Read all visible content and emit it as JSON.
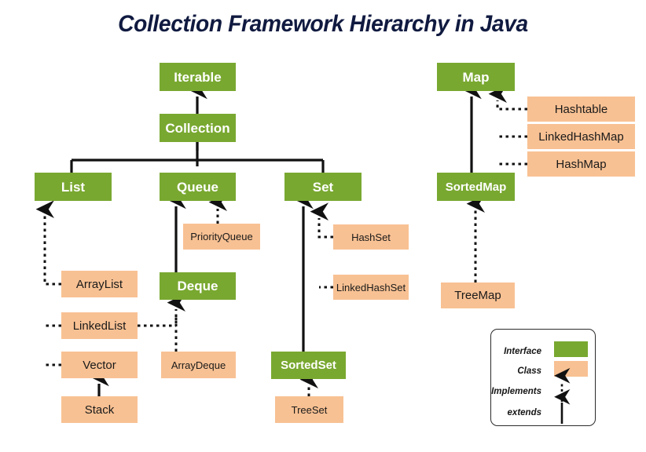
{
  "title": "Collection Framework Hierarchy in Java",
  "colors": {
    "interface": "#79a830",
    "class": "#f8c193",
    "title": "#101a40",
    "line": "#111111",
    "background": "#ffffff"
  },
  "nodes": {
    "iterable": "Iterable",
    "collection": "Collection",
    "list": "List",
    "queue": "Queue",
    "set": "Set",
    "arraylist": "ArrayList",
    "linkedlist": "LinkedList",
    "vector": "Vector",
    "stack": "Stack",
    "priorityqueue": "PriorityQueue",
    "deque": "Deque",
    "arraydeque": "ArrayDeque",
    "hashset": "HashSet",
    "linkedhashset": "LinkedHashSet",
    "sortedset": "SortedSet",
    "treeset": "TreeSet",
    "map": "Map",
    "hashtable": "Hashtable",
    "linkedhashmap": "LinkedHashMap",
    "hashmap": "HashMap",
    "sortedmap": "SortedMap",
    "treemap": "TreeMap"
  },
  "legend": {
    "interface_label": "Interface",
    "class_label": "Class",
    "implements_label": "Implements",
    "extends_label": "extends"
  },
  "chart_data": {
    "type": "diagram",
    "title": "Collection Framework Hierarchy in Java",
    "node_kinds": {
      "interface": [
        "Iterable",
        "Collection",
        "List",
        "Queue",
        "Set",
        "Deque",
        "SortedSet",
        "Map",
        "SortedMap"
      ],
      "class": [
        "ArrayList",
        "LinkedList",
        "Vector",
        "Stack",
        "PriorityQueue",
        "ArrayDeque",
        "HashSet",
        "LinkedHashSet",
        "TreeSet",
        "Hashtable",
        "LinkedHashMap",
        "HashMap",
        "TreeMap"
      ]
    },
    "edges": [
      {
        "from": "Collection",
        "to": "Iterable",
        "kind": "extends"
      },
      {
        "from": "List",
        "to": "Collection",
        "kind": "extends"
      },
      {
        "from": "Queue",
        "to": "Collection",
        "kind": "extends"
      },
      {
        "from": "Set",
        "to": "Collection",
        "kind": "extends"
      },
      {
        "from": "ArrayList",
        "to": "List",
        "kind": "implements"
      },
      {
        "from": "LinkedList",
        "to": "List",
        "kind": "implements"
      },
      {
        "from": "Vector",
        "to": "List",
        "kind": "implements"
      },
      {
        "from": "Stack",
        "to": "Vector",
        "kind": "extends"
      },
      {
        "from": "PriorityQueue",
        "to": "Queue",
        "kind": "implements"
      },
      {
        "from": "Deque",
        "to": "Queue",
        "kind": "extends"
      },
      {
        "from": "ArrayDeque",
        "to": "Deque",
        "kind": "implements"
      },
      {
        "from": "LinkedList",
        "to": "Deque",
        "kind": "implements"
      },
      {
        "from": "HashSet",
        "to": "Set",
        "kind": "implements"
      },
      {
        "from": "LinkedHashSet",
        "to": "Set",
        "kind": "implements"
      },
      {
        "from": "SortedSet",
        "to": "Set",
        "kind": "extends"
      },
      {
        "from": "TreeSet",
        "to": "SortedSet",
        "kind": "implements"
      },
      {
        "from": "Hashtable",
        "to": "Map",
        "kind": "implements"
      },
      {
        "from": "LinkedHashMap",
        "to": "Map",
        "kind": "implements"
      },
      {
        "from": "HashMap",
        "to": "Map",
        "kind": "implements"
      },
      {
        "from": "SortedMap",
        "to": "Map",
        "kind": "extends"
      },
      {
        "from": "TreeMap",
        "to": "SortedMap",
        "kind": "implements"
      }
    ]
  }
}
